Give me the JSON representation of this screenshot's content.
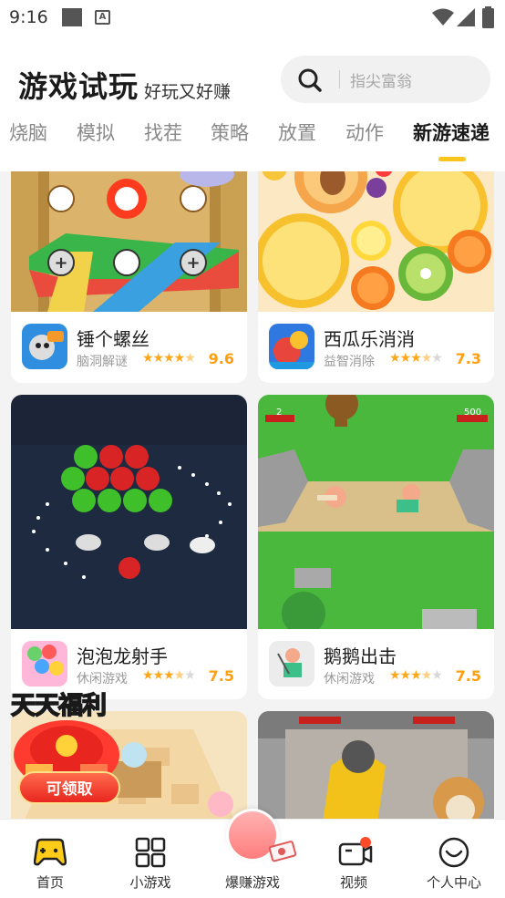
{
  "status_bar": {
    "time": "9:16"
  },
  "header": {
    "brand": "游戏试玩",
    "slogan": "好玩又好赚",
    "search_placeholder": "指尖富翁"
  },
  "tabs": [
    {
      "label": "烧脑"
    },
    {
      "label": "模拟"
    },
    {
      "label": "找茬"
    },
    {
      "label": "策略"
    },
    {
      "label": "放置"
    },
    {
      "label": "动作"
    },
    {
      "label": "新游速递",
      "active": true
    }
  ],
  "games": [
    {
      "name": "锤个螺丝",
      "category": "脑洞解谜",
      "rating": 9.6,
      "stars": 4.5
    },
    {
      "name": "西瓜乐消消",
      "category": "益智消除",
      "rating": 7.3,
      "stars": 3.5
    },
    {
      "name": "泡泡龙射手",
      "category": "休闲游戏",
      "rating": 7.5,
      "stars": 3.5
    },
    {
      "name": "鹅鹅出击",
      "category": "休闲游戏",
      "rating": 7.5,
      "stars": 3.5
    }
  ],
  "art_text": {
    "hp_left": "2",
    "hp_right": "500"
  },
  "promo": {
    "title_a": "天天",
    "title_b": "福利",
    "button": "可领取"
  },
  "bottom_nav": [
    {
      "label": "首页"
    },
    {
      "label": "小游戏"
    },
    {
      "label": "爆赚游戏"
    },
    {
      "label": "视频"
    },
    {
      "label": "个人中心"
    }
  ],
  "colors": {
    "accent": "#f7c51b",
    "rating": "#ff9f10",
    "badge": "#ff4a2a"
  }
}
